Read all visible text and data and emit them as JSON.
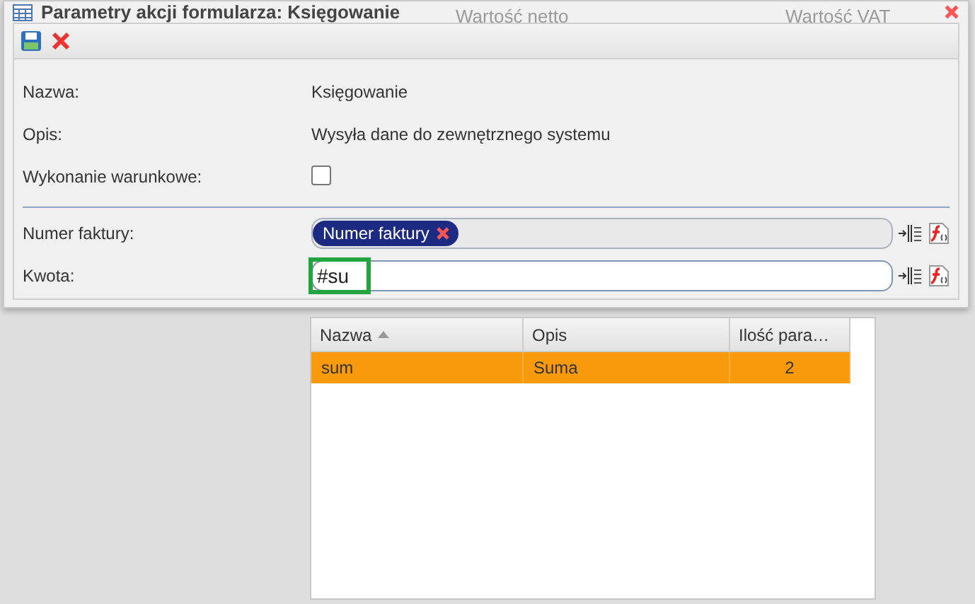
{
  "background": {
    "headers": [
      "Wartość netto",
      "Wartość VAT"
    ]
  },
  "window": {
    "title": "Parametry akcji formularza: Księgowanie"
  },
  "toolbar": {
    "buttons": [
      {
        "kind": "save"
      },
      {
        "kind": "delete"
      }
    ]
  },
  "info_rows": [
    {
      "label": "Nazwa:",
      "value": "Księgowanie"
    },
    {
      "label": "Opis:",
      "value": "Wysyła dane do zewnętrznego systemu"
    }
  ],
  "conditional": {
    "label": "Wykonanie warunkowe:",
    "checked": false
  },
  "params": [
    {
      "label": "Numer faktury:",
      "tokens": [
        "Numer faktury"
      ],
      "focused": false
    },
    {
      "label": "Kwota:",
      "value": "#su",
      "focused": true
    }
  ],
  "suggestions": {
    "columns": [
      {
        "label": "Nazwa",
        "sorted": true
      },
      {
        "label": "Opis",
        "sorted": false
      },
      {
        "label": "Ilość para…",
        "sorted": false
      }
    ],
    "rows": [
      {
        "cells": [
          "sum",
          "Suma",
          "2"
        ],
        "selected": true
      }
    ]
  }
}
